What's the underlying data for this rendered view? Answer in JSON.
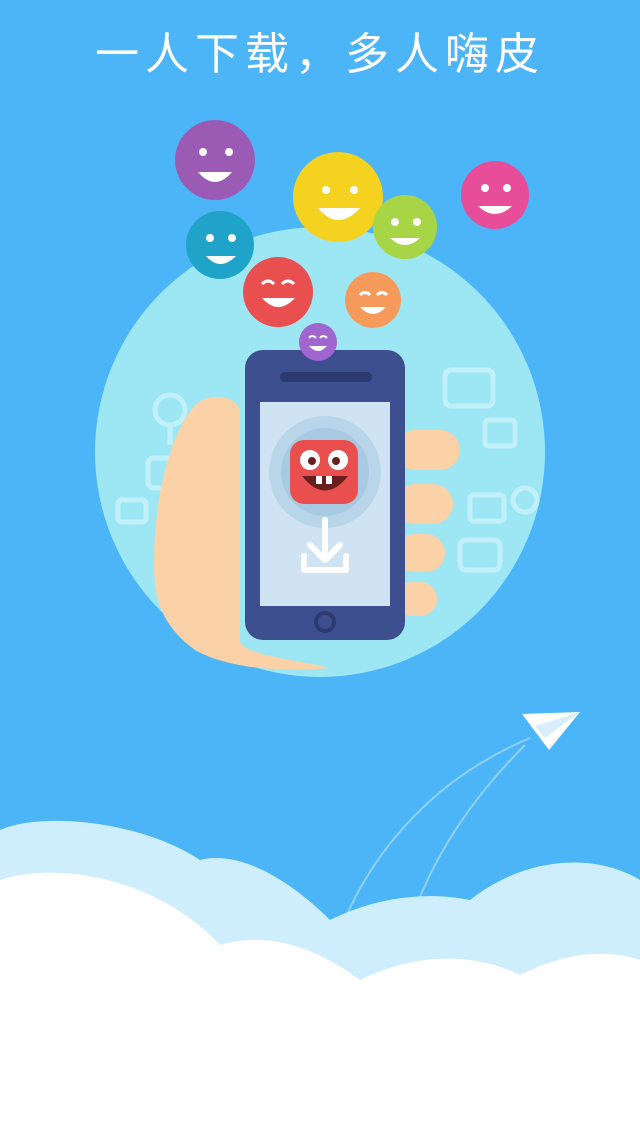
{
  "screen": {
    "headline": "一人下载，多人嗨皮",
    "background_color": "#4bb5f8"
  },
  "illustration": {
    "emoji_bubble_colors": [
      "#9b5bb5",
      "#1fa3c8",
      "#f5d21f",
      "#a7d545",
      "#e84d99",
      "#ea4f4f",
      "#f59a5b",
      "#a065cf"
    ],
    "circle_color": "#9de7f5",
    "phone_color": "#3e4f8f",
    "app_icon_color": "#ea4f4f",
    "icons": [
      "smiley-bubble-icon",
      "phone-icon",
      "hand-icon",
      "app-monster-icon",
      "download-icon",
      "paper-plane-icon",
      "cloud-icon"
    ]
  }
}
